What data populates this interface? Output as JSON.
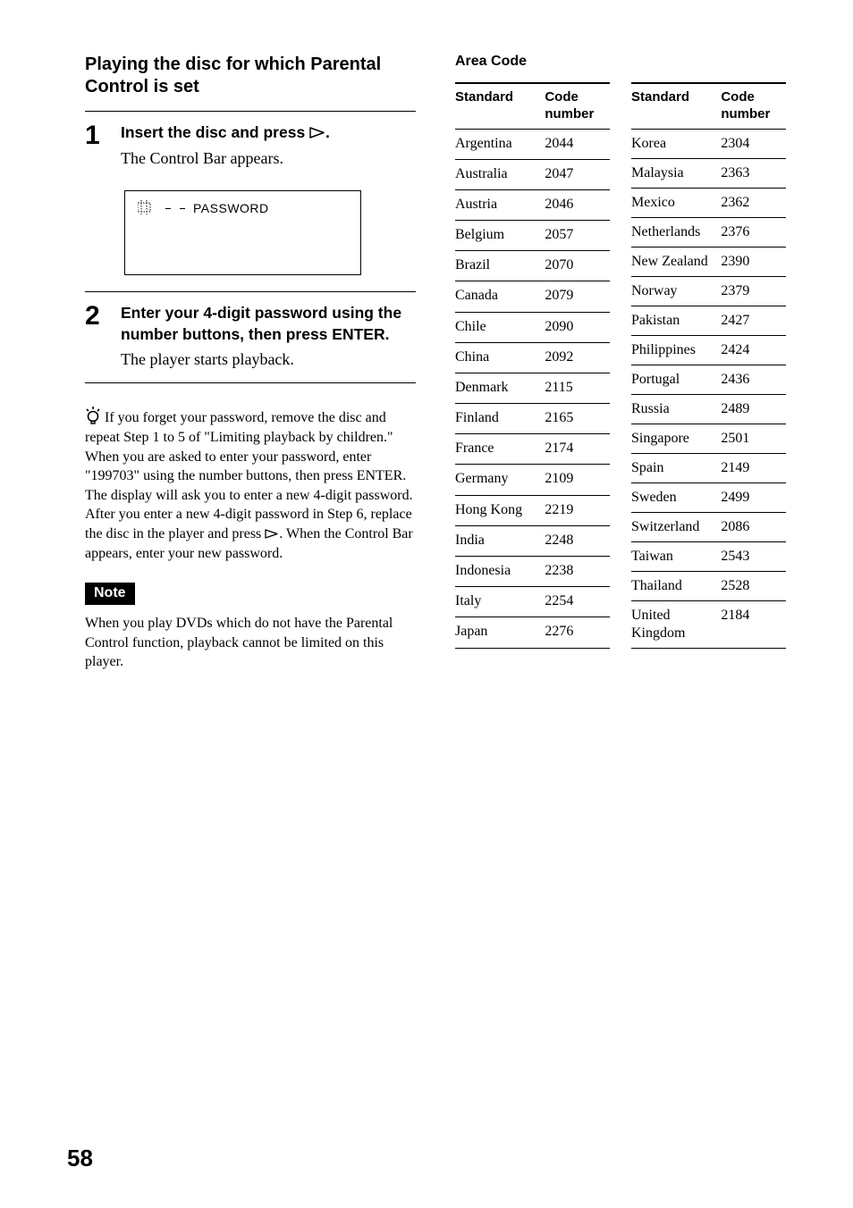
{
  "left": {
    "heading": "Playing the disc for which Parental Control is set",
    "steps": [
      {
        "num": "1",
        "instruction_pre": "Insert the disc and press ",
        "instruction_post": ".",
        "desc": "The Control Bar appears.",
        "screen": {
          "text": "PASSWORD"
        }
      },
      {
        "num": "2",
        "instruction": "Enter your 4-digit password using the number buttons, then press ENTER.",
        "desc": "The player starts playback."
      }
    ],
    "tip": "If you forget your password, remove the disc and repeat Step 1 to 5 of \"Limiting playback by children.\" When you are asked to enter your password, enter \"199703\" using the number buttons, then press ENTER. The display will ask you to enter a new 4-digit password. After you enter a new 4-digit password in Step 6, replace the disc in the player and press ",
    "tip_post": ". When the Control Bar appears, enter your new password.",
    "note_label": "Note",
    "note_text": "When you play DVDs which do not have the Parental Control function, playback cannot be limited on this player."
  },
  "right": {
    "title": "Area Code",
    "headers": {
      "standard": "Standard",
      "code": "Code number"
    },
    "rows_left": [
      {
        "standard": "Argentina",
        "code": "2044"
      },
      {
        "standard": "Australia",
        "code": "2047"
      },
      {
        "standard": "Austria",
        "code": "2046"
      },
      {
        "standard": "Belgium",
        "code": "2057"
      },
      {
        "standard": "Brazil",
        "code": "2070"
      },
      {
        "standard": "Canada",
        "code": "2079"
      },
      {
        "standard": "Chile",
        "code": "2090"
      },
      {
        "standard": "China",
        "code": "2092"
      },
      {
        "standard": "Denmark",
        "code": "2115"
      },
      {
        "standard": "Finland",
        "code": "2165"
      },
      {
        "standard": "France",
        "code": "2174"
      },
      {
        "standard": "Germany",
        "code": "2109"
      },
      {
        "standard": "Hong Kong",
        "code": "2219"
      },
      {
        "standard": "India",
        "code": "2248"
      },
      {
        "standard": "Indonesia",
        "code": "2238"
      },
      {
        "standard": "Italy",
        "code": "2254"
      },
      {
        "standard": "Japan",
        "code": "2276"
      }
    ],
    "rows_right": [
      {
        "standard": "Korea",
        "code": "2304"
      },
      {
        "standard": "Malaysia",
        "code": "2363"
      },
      {
        "standard": "Mexico",
        "code": "2362"
      },
      {
        "standard": "Netherlands",
        "code": "2376"
      },
      {
        "standard": "New Zealand",
        "code": "2390"
      },
      {
        "standard": "Norway",
        "code": "2379"
      },
      {
        "standard": "Pakistan",
        "code": "2427"
      },
      {
        "standard": "Philippines",
        "code": "2424"
      },
      {
        "standard": "Portugal",
        "code": "2436"
      },
      {
        "standard": "Russia",
        "code": "2489"
      },
      {
        "standard": "Singapore",
        "code": "2501"
      },
      {
        "standard": "Spain",
        "code": "2149"
      },
      {
        "standard": "Sweden",
        "code": "2499"
      },
      {
        "standard": "Switzerland",
        "code": "2086"
      },
      {
        "standard": "Taiwan",
        "code": "2543"
      },
      {
        "standard": "Thailand",
        "code": "2528"
      },
      {
        "standard": "United Kingdom",
        "code": "2184"
      }
    ]
  },
  "page_number": "58"
}
